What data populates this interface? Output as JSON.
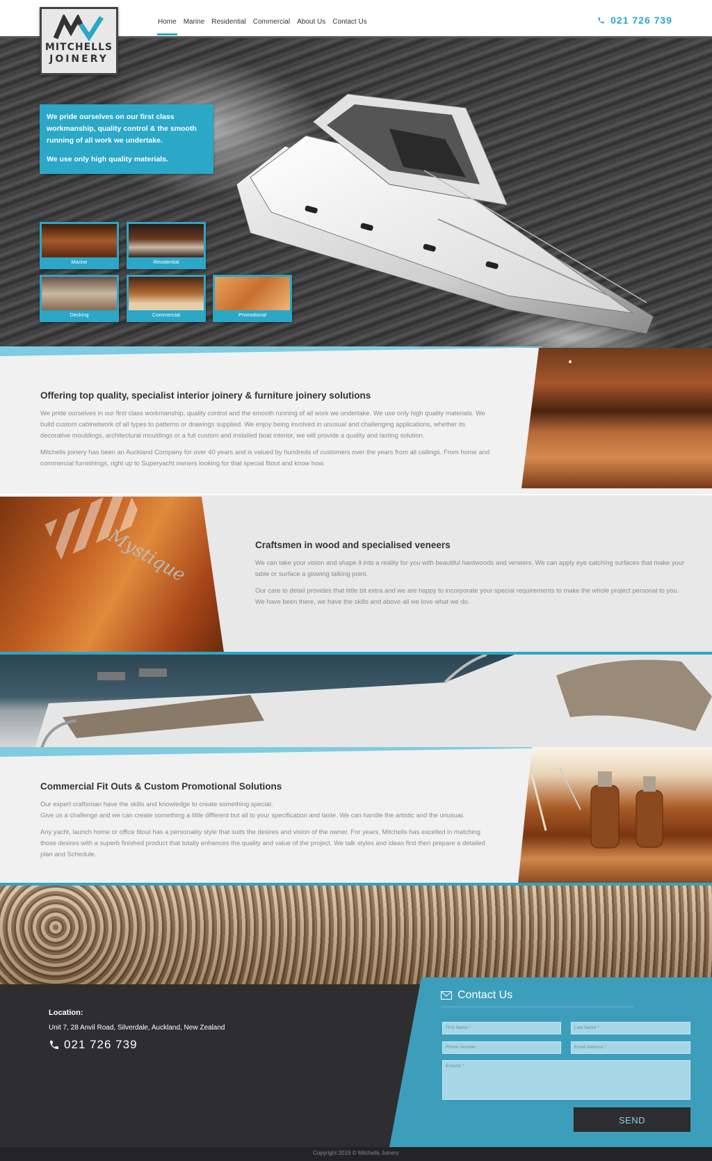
{
  "brand": {
    "logo_line1": "MITCHELLS",
    "logo_line2": "JOINERY",
    "accent": "#2ba7c8"
  },
  "nav": {
    "items": [
      "Home",
      "Marine",
      "Residential",
      "Commercial",
      "About Us",
      "Contact Us"
    ],
    "active": "Home"
  },
  "header": {
    "phone": "021 726 739"
  },
  "hero": {
    "box_text_1": "We pride ourselves on our first class workmanship, quality control & the smooth running of all work we undertake.",
    "box_text_2": "We use only high quality materials.",
    "thumbnails": [
      "Marine",
      "Residential",
      "Decking",
      "Commercial",
      "Promotional"
    ]
  },
  "section1": {
    "title": "Offering top quality, specialist interior joinery & furniture joinery solutions",
    "p1": "We pride ourselves in our first class workmanship, quality control and the smooth running of all work we undertake. We use only high quality materials. We build custom cabinetwork of all types to patterns or drawings supplied. We enjoy being involved in unusual and challenging applications, whether its decorative mouldings, architectural mouldings or a full custom and installed boat interior, we will provide a quality and lasting solution.",
    "p2": "Mitchells joinery has been an Auckland Company for over 40 years and is valued by hundreds of customers over the years from all callings. From home and commercial furnishings, right up to Superyacht owners looking for that special fitout and know how."
  },
  "section2": {
    "title": "Craftsmen in wood and specialised veneers",
    "p1": "We can take your vision and shape it into a reality for you with beautiful hardwoods and veneers. We can apply eye catching surfaces that make your table or surface a glowing talking point.",
    "p2": "Our care to detail provides that little bit extra and we are happy to incorporate your special requirements to make the whole project personal to you. We have been there, we have the skills and above all we love what we do.",
    "image_script": "Mystique"
  },
  "section3": {
    "title": "Commercial Fit Outs & Custom Promotional Solutions",
    "p1a": "Our expert craftsman have the skills and knowledge to create something special.",
    "p1b": "Give us a challenge and we can create something a little different but all to your specification and taste. We can handle the artistic and the unusual.",
    "p2": "Any yacht, launch home or office fitout has a personality style that suits the desires and vision of the owner. For years, Mitchells has excelled in matching those desires with a superb finished product that totally enhances the quality and value of the project. We talk styles and ideas first then prepare a detailed plan and Schedule."
  },
  "footer": {
    "location_label": "Location:",
    "address": "Unit 7, 28 Anvil Road, Silverdale, Auckland, New Zealand",
    "phone": "021 726 739",
    "contact_title": "Contact Us",
    "first_name": "First Name *",
    "last_name": "Last Name *",
    "phone_number": "Phone Number",
    "email": "Email Address *",
    "enquiry": "Enquiry *",
    "send": "SEND",
    "copyright": "Copyright 2019 © Mitchells Joinery"
  }
}
